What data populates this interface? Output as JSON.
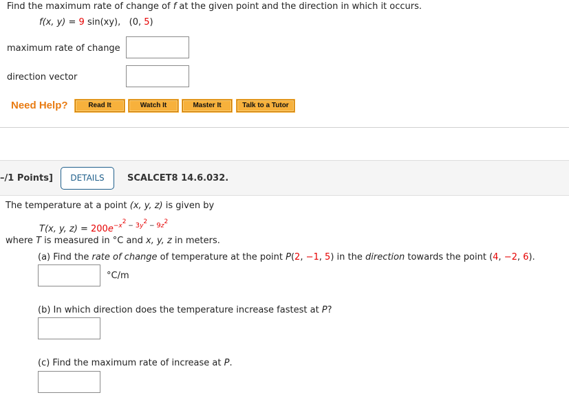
{
  "q1": {
    "prompt_before_f": "Find the maximum rate of change of ",
    "prompt_f": "f",
    "prompt_after_f": " at the given point and the direction in which it occurs.",
    "func_lhs": "f(x, y)",
    "func_eq": " = ",
    "func_coef": "9",
    "func_rest": " sin(xy),",
    "point_open": "(0, ",
    "point_val": "5",
    "point_close": ")",
    "fields": [
      {
        "label": "maximum rate of change",
        "value": ""
      },
      {
        "label": "direction vector",
        "value": ""
      }
    ],
    "help": {
      "label": "Need Help?",
      "buttons": [
        "Read It",
        "Watch It",
        "Master It",
        "Talk to a Tutor"
      ]
    }
  },
  "q2": {
    "points": "–/1 Points]",
    "details_label": "DETAILS",
    "code": "SCALCET8 14.6.032.",
    "intro_before": "The temperature at a point ",
    "intro_point": "(x, y, z)",
    "intro_after": " is given by",
    "eq_lhs": "T(x, y, z)",
    "eq_eq": " = ",
    "eq_coef": "200",
    "eq_e": "e",
    "eq_exp_1": "−x",
    "eq_exp_2": "2",
    "eq_exp_3": " − ",
    "eq_exp_4": "3",
    "eq_exp_5": "y",
    "eq_exp_6": "2",
    "eq_exp_7": " − ",
    "eq_exp_8": "9",
    "eq_exp_9": "z",
    "eq_exp_10": "2",
    "where_1": "where ",
    "where_T": "T",
    "where_2": " is measured in °C and ",
    "where_vars": "x, y, z",
    "where_3": " in meters.",
    "part_a": {
      "t1": "(a) Find the ",
      "t2": "rate of change",
      "t3": " of temperature at the point ",
      "p": "P",
      "p_open": "(",
      "p1": "2",
      "sep1": ", ",
      "p2": "−1",
      "sep2": ", ",
      "p3": "5",
      "p_close": ")",
      "t4": " in the ",
      "t5": "direction",
      "t6": " towards the point ",
      "q_open": "(",
      "q1": "4",
      "qsep1": ", ",
      "q2": "−2",
      "qsep2": ", ",
      "q3": "6",
      "q_close": ").",
      "unit": "°C/m",
      "value": ""
    },
    "part_b": {
      "t1": "(b) In which direction does the temperature increase fastest at ",
      "p": "P",
      "t2": "?",
      "value": ""
    },
    "part_c": {
      "t1": "(c) Find the maximum rate of increase at ",
      "p": "P",
      "t2": ".",
      "value": ""
    }
  }
}
